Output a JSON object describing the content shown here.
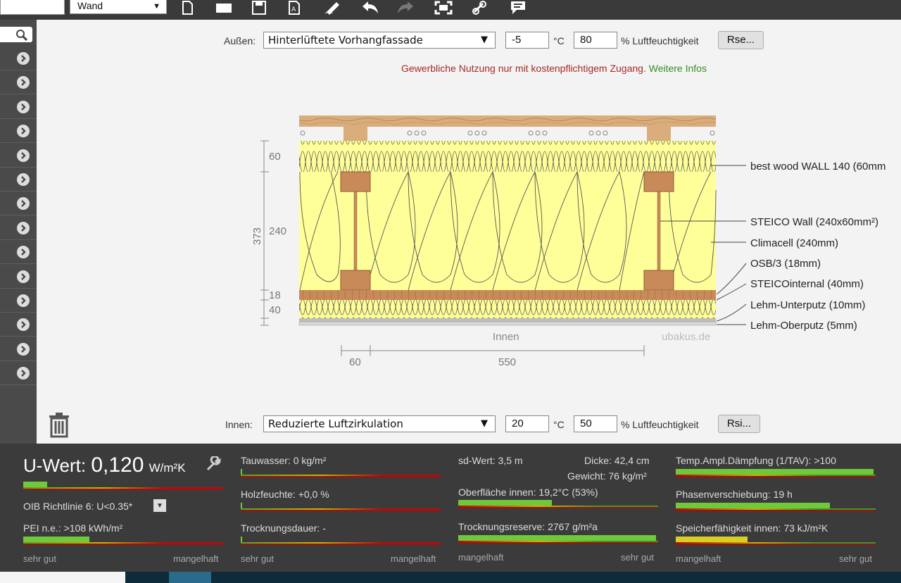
{
  "toolbar": {
    "name_value": "",
    "type_value": "Wand",
    "icons": [
      "new-file-icon",
      "folder-icon",
      "save-icon",
      "pdf-icon",
      "edit-icon",
      "undo-icon",
      "redo-icon",
      "fullscreen-icon",
      "link-icon",
      "comment-icon"
    ]
  },
  "outside": {
    "label": "Außen:",
    "condition": "Hinterlüftete Vorhangfassade",
    "temperature": "-5",
    "temp_unit": "°C",
    "humidity": "80",
    "humidity_unit": "% Luftfeuchtigkeit",
    "rse_button": "Rse..."
  },
  "notice": {
    "text": "Gewerbliche Nutzung nur mit kostenpflichtigem Zugang.",
    "link": "Weitere Infos"
  },
  "inside": {
    "label": "Innen:",
    "condition": "Reduzierte Luftzirkulation",
    "temperature": "20",
    "temp_unit": "°C",
    "humidity": "50",
    "humidity_unit": "% Luftfeuchtigkeit",
    "rsi_button": "Rsi..."
  },
  "diagram": {
    "dims_left": [
      "60",
      "240",
      "18",
      "40"
    ],
    "total": "373",
    "dims_bottom": [
      "60",
      "550"
    ],
    "inner_label": "Innen",
    "watermark": "ubakus.de",
    "layers": [
      "best wood WALL 140 (60mm",
      "STEICO  Wall (240x60mm²)",
      "Climacell (240mm)",
      "OSB/3 (18mm)",
      "STEICOinternal (40mm)",
      "Lehm-Unterputz (10mm)",
      "Lehm-Oberputz (5mm)"
    ]
  },
  "results": {
    "u_label": "U-Wert:",
    "u_value": "0,120",
    "u_unit": "W/m²K",
    "oib": "OIB Richtlinie 6: U<0.35*",
    "pei": "PEI n.e.: >108 kWh/m²",
    "tauwasser": "Tauwasser: 0 kg/m²",
    "holzfeuchte": "Holzfeuchte: +0,0 %",
    "trocknungsdauer": "Trocknungsdauer: -",
    "sd": "sd-Wert: 3,5 m",
    "dicke": "Dicke: 42,4 cm",
    "gewicht": "Gewicht: 76 kg/m²",
    "oberflaeche": "Oberfläche innen: 19,2°C (53%)",
    "trocknungsreserve": "Trocknungsreserve: 2767 g/m²a",
    "temp_ampl": "Temp.Ampl.Dämpfung (1/TAV): >100",
    "phasen": "Phasenverschiebung: 19 h",
    "speicher": "Speicherfähigkeit innen: 73 kJ/m²K",
    "scale_good": "sehr gut",
    "scale_bad": "mangelhaft",
    "levels": {
      "u": 0.12,
      "pei": 0.33,
      "tauwasser": 0.005,
      "holzfeuchte": 0.005,
      "trocknungsdauer": 0.005,
      "oberflaeche": 0.47,
      "trocknungsreserve": 0.99,
      "temp_ampl": 0.99,
      "phasen": 0.77,
      "speicher": 0.36
    }
  }
}
